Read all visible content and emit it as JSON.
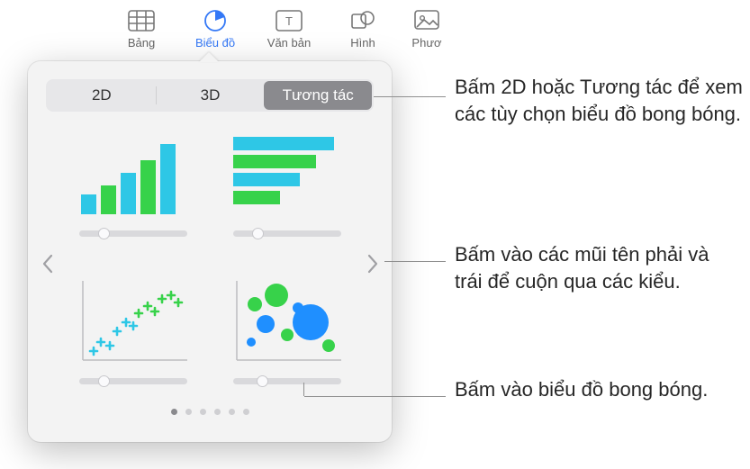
{
  "toolbar": {
    "items": [
      {
        "label": "Bảng",
        "icon": "table-icon"
      },
      {
        "label": "Biểu đồ",
        "icon": "pie-chart-icon"
      },
      {
        "label": "Văn bản",
        "icon": "text-box-icon"
      },
      {
        "label": "Hình",
        "icon": "shape-icon"
      },
      {
        "label": "Phươ",
        "icon": "media-icon"
      }
    ],
    "active_index": 1
  },
  "popover": {
    "segments": {
      "tab2d": "2D",
      "tab3d": "3D",
      "tabInteractive": "Tương tác",
      "active": 2
    },
    "charts": [
      {
        "name": "interactive-column-chart",
        "slider_pos": 0.18
      },
      {
        "name": "interactive-bar-chart",
        "slider_pos": 0.18
      },
      {
        "name": "interactive-scatter-chart",
        "slider_pos": 0.18
      },
      {
        "name": "interactive-bubble-chart",
        "slider_pos": 0.22
      }
    ],
    "page_count": 6,
    "active_page": 0
  },
  "callouts": {
    "c1": "Bấm 2D hoặc Tương tác để xem các tùy chọn biểu đồ bong bóng.",
    "c2": "Bấm vào các mũi tên phải và trái để cuộn qua các kiểu.",
    "c3": "Bấm vào biểu đồ bong bóng."
  },
  "colors": {
    "cyan": "#2ec7e6",
    "green": "#37d24a",
    "blue": "#1f8fff"
  }
}
